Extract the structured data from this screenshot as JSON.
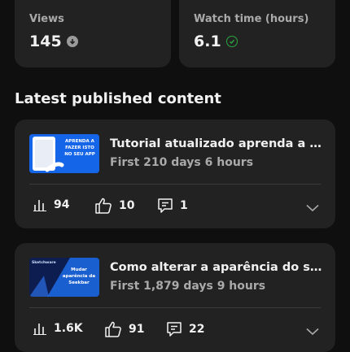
{
  "stats": [
    {
      "label": "Views",
      "value": "145",
      "trend": "down"
    },
    {
      "label": "Watch time (hours)",
      "value": "6.1",
      "trend": "check"
    }
  ],
  "section_title": "Latest published content",
  "videos": [
    {
      "title": "Tutorial atualizado aprenda a fazer isto no seu app",
      "subtitle": "First 210 days 6 hours",
      "thumbnail_text": "APRENDA A FAZER ISTO NO SEU APP",
      "views": "94",
      "likes": "10",
      "comments": "1"
    },
    {
      "title": "Como alterar a aparência do seekbar",
      "subtitle": "First 1,879 days 9 hours",
      "thumbnail_text": "Mudar aparência da Seekbar",
      "thumbnail_brand": "Sketchware",
      "views": "1.6K",
      "likes": "91",
      "comments": "22"
    }
  ],
  "colors": {
    "background": "#0f0f0f",
    "card": "#222222",
    "positive": "#2ba640",
    "muted": "#aaaaaa"
  }
}
